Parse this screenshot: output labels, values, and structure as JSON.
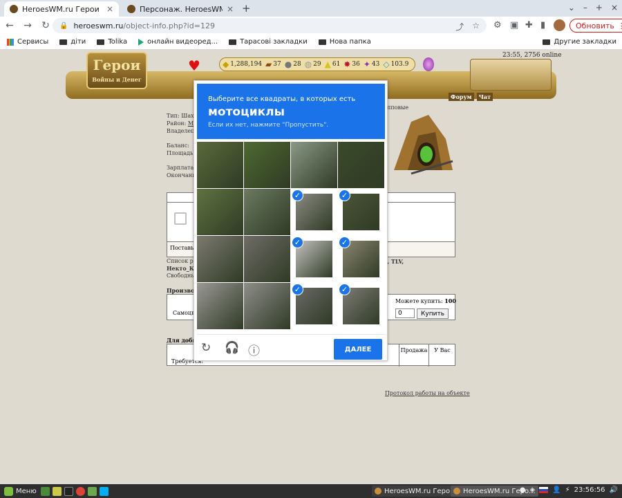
{
  "browser": {
    "tabs": [
      {
        "title": "HeroesWM.ru Герои войны и ..."
      },
      {
        "title": "Персонаж. HeroesWM.ru Геро..."
      }
    ],
    "new_tab_glyph": "+",
    "window_controls": [
      "⌄",
      "–",
      "+",
      "×"
    ],
    "url_host": "heroeswm.ru",
    "url_path": "/object-info.php?id=129",
    "update_label": "Обновить",
    "bookmarks": [
      "Сервисы",
      "діти",
      "Tolika",
      "онлайн видеоред...",
      "Тарасові закладки",
      "Нова папка"
    ],
    "bookmarks_right": "Другие закладки"
  },
  "game_header": {
    "logo_title": "Герои",
    "logo_subtitle": "Войны и Денег",
    "resources": [
      {
        "icon": "gold-icon",
        "glyph": "◆",
        "value": "1,288,194"
      },
      {
        "icon": "wood-icon",
        "glyph": "▰",
        "value": "37"
      },
      {
        "icon": "ore-icon",
        "glyph": "●",
        "value": "28"
      },
      {
        "icon": "mercury-icon",
        "glyph": "◍",
        "value": "29"
      },
      {
        "icon": "sulfur-icon",
        "glyph": "▲",
        "value": "61"
      },
      {
        "icon": "crystal-icon",
        "glyph": "✸",
        "value": "36"
      },
      {
        "icon": "gems-icon",
        "glyph": "✦",
        "value": "43"
      },
      {
        "icon": "diamond-icon",
        "glyph": "◇",
        "value": "103.9"
      }
    ],
    "online_text": "23:55, 2756 online",
    "menu_items": [
      "Форум",
      "Чат"
    ]
  },
  "object_info": {
    "type_label": "Тип: Шахт",
    "district_label": "Район:",
    "district_link": "Mi",
    "owner_label": "Владелец:",
    "balance_label": "Баланс:",
    "area_label": "Площадь:",
    "salary_label": "Зарплата:",
    "end_label": "Окончани",
    "group_suffix": "пповые",
    "post_label": "Поставьт",
    "workers_prefix": "Список ра",
    "workers_names": "ych, TLV,",
    "workers_name2": "Некто_К",
    "free_label": "Свободны"
  },
  "production": {
    "label": "Производ",
    "row_label": "Самоцв",
    "can_buy_label": "Можете купить:",
    "can_buy_value": "100",
    "qty_value": "0",
    "buy_label": "Купить"
  },
  "mining": {
    "label": "Для добы",
    "col_sale": "Продажа",
    "col_have": "У Вас",
    "row_label": "Требуется:",
    "protocol_link": "Протокол работы на объекте"
  },
  "captcha": {
    "instruction": "Выберите все квадраты, в которых есть",
    "target": "мотоциклы",
    "hint": "Если их нет, нажмите \"Пропустить\".",
    "next_label": "ДАЛЕЕ",
    "selected_tiles": [
      6,
      7,
      10,
      11,
      14,
      15
    ],
    "tile_colors": [
      "#5a6b3a",
      "#4e6a31",
      "#8a9a86",
      "#3a4a2a",
      "#5f7340",
      "#6b7a60",
      "#8c8a82",
      "#4a5538",
      "#7c7a70",
      "#6e6c66",
      "#c4c3bf",
      "#8a8570",
      "#9a9894",
      "#8e8d89",
      "#6a6966",
      "#7d7b75"
    ],
    "icons": [
      "reload-icon",
      "audio-icon",
      "info-icon"
    ]
  },
  "taskbar": {
    "menu_label": "Меню",
    "tasks": [
      "HeroesWM.ru Геро...",
      "HeroesWM.ru Геро..."
    ],
    "clock": "23:56:56"
  }
}
